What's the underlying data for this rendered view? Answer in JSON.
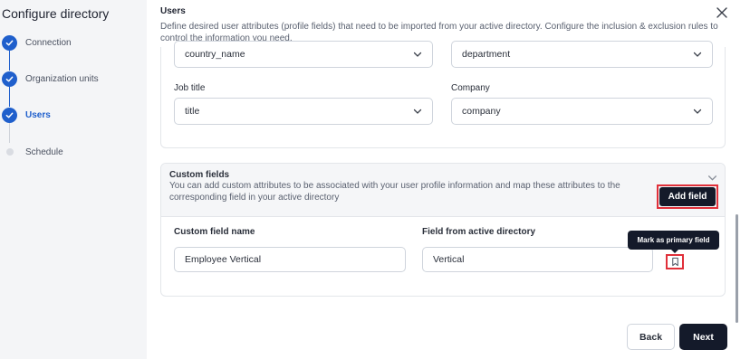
{
  "sidebar": {
    "title": "Configure directory",
    "steps": [
      {
        "label": "Connection",
        "state": "done"
      },
      {
        "label": "Organization units",
        "state": "done"
      },
      {
        "label": "Users",
        "state": "active"
      },
      {
        "label": "Schedule",
        "state": "pending"
      }
    ]
  },
  "users": {
    "title": "Users",
    "description": "Define desired user attributes (profile fields) that need to be imported from your active directory. Configure the inclusion & exclusion rules to control the information you need.",
    "row1": {
      "left_value": "country_name",
      "right_value": "department"
    },
    "job_title": {
      "label": "Job title",
      "value": "title"
    },
    "company": {
      "label": "Company",
      "value": "company"
    }
  },
  "custom_fields": {
    "title": "Custom fields",
    "description": "You can add custom attributes to be associated with your user profile information and map these attributes to the corresponding field in your active directory",
    "add_button": "Add field",
    "name_label": "Custom field name",
    "name_value": "Employee Vertical",
    "ad_label": "Field from active directory",
    "ad_value": "Vertical",
    "tooltip": "Mark as primary field"
  },
  "footer": {
    "back": "Back",
    "next": "Next"
  },
  "colors": {
    "accent": "#1f5fcc",
    "dark_button": "#141a2a",
    "highlight": "#e0303a"
  },
  "icons": [
    "check-icon",
    "close-icon",
    "chevron-down-icon",
    "bookmark-icon"
  ]
}
